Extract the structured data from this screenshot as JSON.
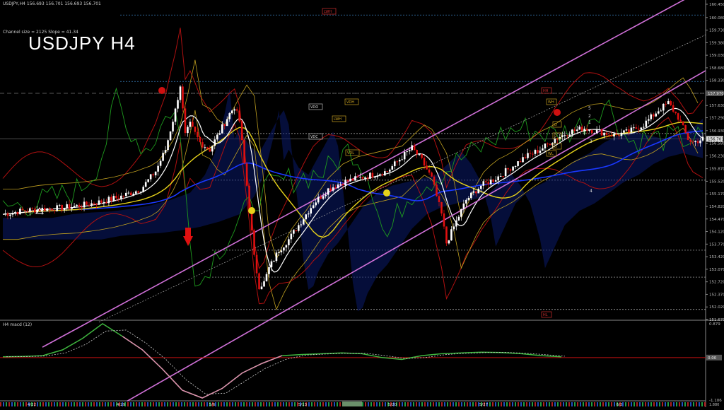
{
  "window": {
    "header": "USDJPY,H4  156.693 156.701 156.693 156.701",
    "indicator_info": "Channel size = 2125 Slope = 41.34",
    "overlay_title": "USDJPY H4",
    "subwindow_label": "H4  macd (12)"
  },
  "price_axis": {
    "ticks": [
      "160.450",
      "160.080",
      "159.730",
      "159.380",
      "159.030",
      "158.680",
      "158.330",
      "157.980",
      "157.630",
      "157.290",
      "156.930",
      "156.580",
      "156.230",
      "155.870",
      "155.520",
      "155.170",
      "154.820",
      "154.470",
      "154.120",
      "153.770",
      "153.420",
      "153.070",
      "152.720",
      "152.370",
      "152.020",
      "151.670"
    ],
    "current_price": "156.701",
    "marker_price": "157.970"
  },
  "macd_axis": {
    "ticks": [
      "0.879",
      "0.00",
      "-1.106"
    ],
    "top_value": "0.879",
    "zero_value": "0.00",
    "bottom_value": "-1.106",
    "corner_value": "1.880"
  },
  "time_axis": {
    "labels": [
      "4/22",
      "4/29",
      "5/6",
      "5/13",
      "5/20",
      "5/27",
      "6/3"
    ]
  },
  "annotations": {
    "level_tags": [
      "LWH",
      "VDH",
      "LWH",
      "VDO",
      "VDC",
      "VDL",
      "HH",
      "HL",
      "WH",
      "WL",
      "D",
      "D",
      "D"
    ],
    "wave_labels": [
      "5",
      "2",
      "1",
      "3",
      "4"
    ]
  },
  "colors": {
    "background": "#000000",
    "candle_up": "#ffffff",
    "candle_down": "#e01010",
    "channel": "#d070d8",
    "ma_white": "#ffffff",
    "ma_yellow": "#e6d21a",
    "ma_blue": "#1a38ff",
    "bollinger": "#c0a020",
    "green_line": "#1e9b1e",
    "red_envelope": "#b01010",
    "macd_line": "#3fb63f",
    "macd_signal": "#cccccc",
    "zero_line": "#c01010"
  },
  "chart_data": {
    "type": "candlestick",
    "symbol": "USDJPY",
    "timeframe": "H4",
    "ylim": [
      151.67,
      160.45
    ],
    "x_labels": [
      "4/22",
      "4/29",
      "5/6",
      "5/13",
      "5/20",
      "5/27",
      "6/3"
    ],
    "close_path": [
      [
        0,
        154.6
      ],
      [
        8,
        154.7
      ],
      [
        16,
        154.75
      ],
      [
        24,
        154.78
      ],
      [
        32,
        154.85
      ],
      [
        40,
        154.95
      ],
      [
        48,
        155.1
      ],
      [
        56,
        155.3
      ],
      [
        62,
        155.8
      ],
      [
        66,
        156.4
      ],
      [
        70,
        157.5
      ],
      [
        72,
        158.2
      ],
      [
        74,
        156.8
      ],
      [
        76,
        157.1
      ],
      [
        80,
        156.6
      ],
      [
        84,
        156.4
      ],
      [
        88,
        156.9
      ],
      [
        92,
        157.4
      ],
      [
        94,
        157.6
      ],
      [
        96,
        157.2
      ],
      [
        98,
        156.0
      ],
      [
        100,
        154.8
      ],
      [
        102,
        153.4
      ],
      [
        104,
        152.6
      ],
      [
        106,
        152.7
      ],
      [
        108,
        153.1
      ],
      [
        112,
        153.6
      ],
      [
        116,
        153.9
      ],
      [
        120,
        154.3
      ],
      [
        126,
        154.9
      ],
      [
        132,
        155.3
      ],
      [
        138,
        155.5
      ],
      [
        144,
        155.6
      ],
      [
        150,
        155.7
      ],
      [
        156,
        155.8
      ],
      [
        162,
        156.2
      ],
      [
        166,
        156.45
      ],
      [
        170,
        156.1
      ],
      [
        174,
        155.6
      ],
      [
        178,
        154.6
      ],
      [
        180,
        153.8
      ],
      [
        184,
        154.4
      ],
      [
        188,
        155.0
      ],
      [
        194,
        155.4
      ],
      [
        200,
        155.6
      ],
      [
        206,
        155.9
      ],
      [
        212,
        156.2
      ],
      [
        218,
        156.4
      ],
      [
        224,
        156.7
      ],
      [
        230,
        156.9
      ],
      [
        236,
        157.0
      ],
      [
        242,
        156.9
      ],
      [
        248,
        156.8
      ],
      [
        254,
        156.9
      ],
      [
        260,
        157.1
      ],
      [
        266,
        157.5
      ],
      [
        270,
        157.7
      ],
      [
        274,
        157.3
      ],
      [
        278,
        156.7
      ],
      [
        280,
        156.6
      ],
      [
        284,
        156.7
      ]
    ],
    "series": [
      {
        "name": "macd (12)",
        "values": [
          0.02,
          0.03,
          0.05,
          0.2,
          0.5,
          0.88,
          0.55,
          0.2,
          -0.3,
          -0.85,
          -1.05,
          -0.8,
          -0.4,
          -0.15,
          0.05,
          0.08,
          0.1,
          0.12,
          0.1,
          0.0,
          -0.05,
          0.05,
          0.1,
          0.12,
          0.14,
          0.13,
          0.1,
          0.05,
          0.02
        ]
      }
    ],
    "last_price": 156.701
  }
}
